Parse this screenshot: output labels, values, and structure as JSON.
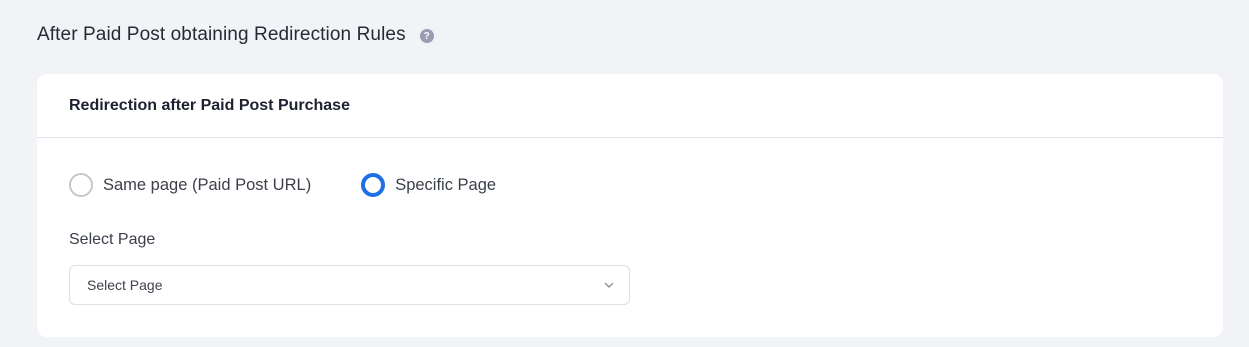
{
  "section": {
    "title": "After Paid Post obtaining Redirection Rules",
    "help_icon": "question-mark-icon"
  },
  "card": {
    "title": "Redirection after Paid Post Purchase",
    "radio_options": [
      {
        "label": "Same page (Paid Post URL)",
        "checked": false
      },
      {
        "label": "Specific Page",
        "checked": true
      }
    ],
    "select_label": "Select Page",
    "select_value": "Select Page",
    "select_icon": "chevron-down-icon"
  },
  "colors": {
    "background": "#f2f3f7",
    "accent": "#1f6fe5",
    "card": "#ffffff"
  }
}
